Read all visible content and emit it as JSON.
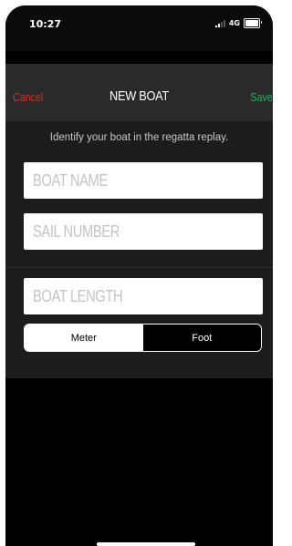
{
  "status_bar": {
    "time": "10:27",
    "network": "4G",
    "icons": [
      "signal-icon",
      "battery-icon"
    ]
  },
  "nav": {
    "cancel_label": "Cancel",
    "title": "NEW BOAT",
    "save_label": "Save"
  },
  "form": {
    "description": "Identify your boat in the regatta replay.",
    "boat_name": {
      "placeholder": "BOAT NAME",
      "value": ""
    },
    "sail_number": {
      "placeholder": "SAIL NUMBER",
      "value": ""
    },
    "boat_length": {
      "placeholder": "BOAT LENGTH",
      "value": ""
    },
    "unit_toggle": {
      "options": [
        "Meter",
        "Foot"
      ],
      "selected": "Meter"
    }
  },
  "colors": {
    "cancel": "#c0392b",
    "save": "#27ae60",
    "nav_background": "#2a2a2a",
    "content_background": "#1c1c1c"
  }
}
